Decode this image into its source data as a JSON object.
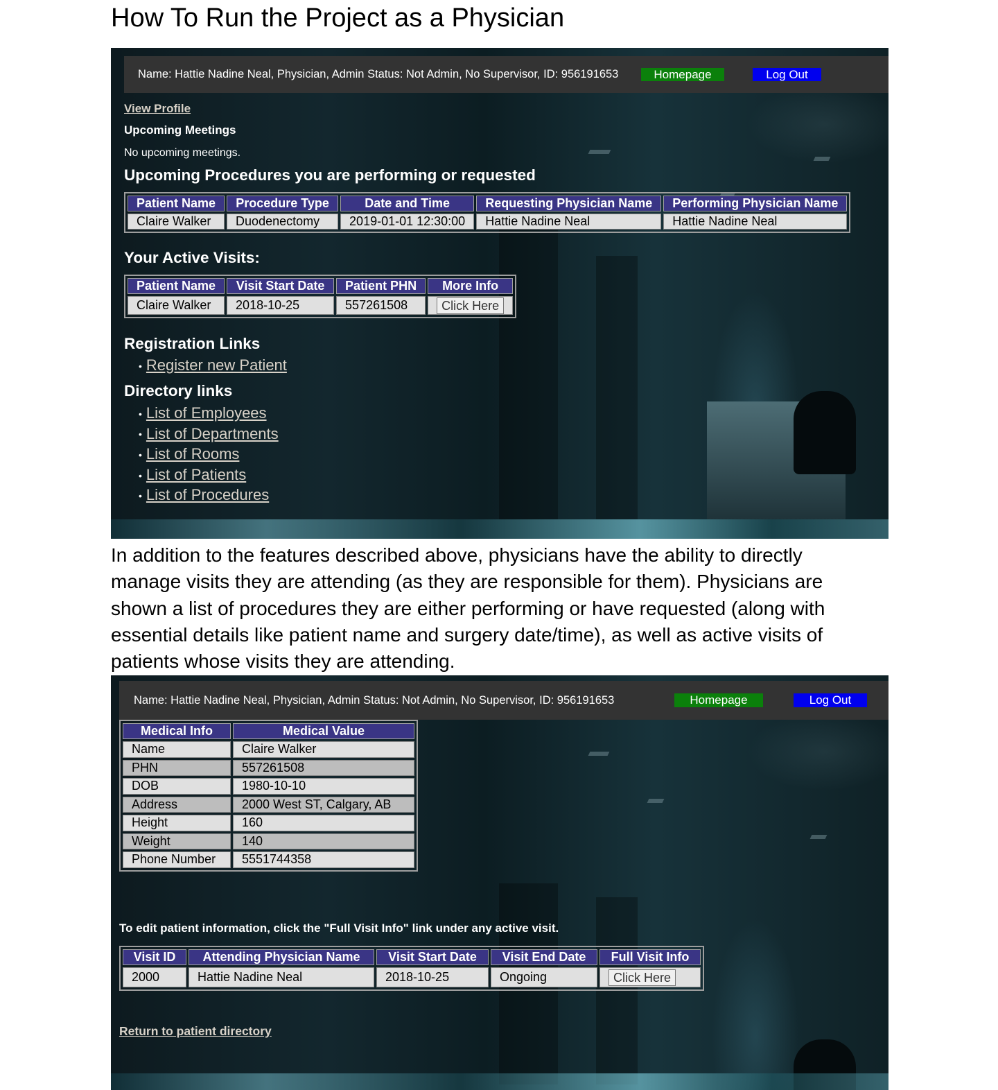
{
  "doc": {
    "title": "How To Run the Project as a Physician",
    "paragraph": "In addition to the features described above, physicians have the ability to directly manage visits they are attending (as they are responsible for them). Physicians  are shown a list of procedures they are either performing or have requested (along with essential details like patient name and surgery date/time), as well as active visits of patients whose visits they are attending."
  },
  "header": {
    "user_info": "Name: Hattie Nadine Neal, Physician, Admin Status: Not Admin, No Supervisor, ID: 956191653",
    "homepage_label": "Homepage",
    "logout_label": "Log Out",
    "homepage_color": "#0b800b",
    "logout_color": "#0000ee"
  },
  "dashboard": {
    "view_profile": "View Profile",
    "upcoming_meetings_heading": "Upcoming Meetings",
    "no_meetings": "No upcoming meetings.",
    "procedures_heading": "Upcoming Procedures you are performing or requested",
    "procedures_columns": [
      "Patient Name",
      "Procedure Type",
      "Date and Time",
      "Requesting Physician Name",
      "Performing Physician Name"
    ],
    "procedures_rows": [
      [
        "Claire Walker",
        "Duodenectomy",
        "2019-01-01 12:30:00",
        "Hattie Nadine Neal",
        "Hattie Nadine Neal"
      ]
    ],
    "visits_heading": "Your Active Visits:",
    "visits_columns": [
      "Patient Name",
      "Visit Start Date",
      "Patient PHN",
      "More Info"
    ],
    "visits_row": {
      "patient": "Claire Walker",
      "start": "2018-10-25",
      "phn": "557261508",
      "button": "Click Here"
    },
    "registration_heading": "Registration Links",
    "registration_links": [
      "Register new Patient"
    ],
    "directory_heading": "Directory links",
    "directory_links": [
      "List of Employees",
      "List of Departments",
      "List of Rooms",
      "List of Patients",
      "List of Procedures"
    ]
  },
  "patient_page": {
    "medical_columns": [
      "Medical Info",
      "Medical Value"
    ],
    "medical_rows": [
      [
        "Name",
        "Claire Walker"
      ],
      [
        "PHN",
        "557261508"
      ],
      [
        "DOB",
        "1980-10-10"
      ],
      [
        "Address",
        "2000 West ST, Calgary, AB"
      ],
      [
        "Height",
        "160"
      ],
      [
        "Weight",
        "140"
      ],
      [
        "Phone Number",
        "5551744358"
      ]
    ],
    "edit_note": "To edit patient information, click the \"Full Visit Info\" link under any active visit.",
    "visit_columns": [
      "Visit ID",
      "Attending Physician Name",
      "Visit Start Date",
      "Visit End Date",
      "Full Visit Info"
    ],
    "visit_row": {
      "id": "2000",
      "physician": "Hattie Nadine Neal",
      "start": "2018-10-25",
      "end": "Ongoing",
      "button": "Click Here"
    },
    "return_link": "Return to patient directory"
  }
}
